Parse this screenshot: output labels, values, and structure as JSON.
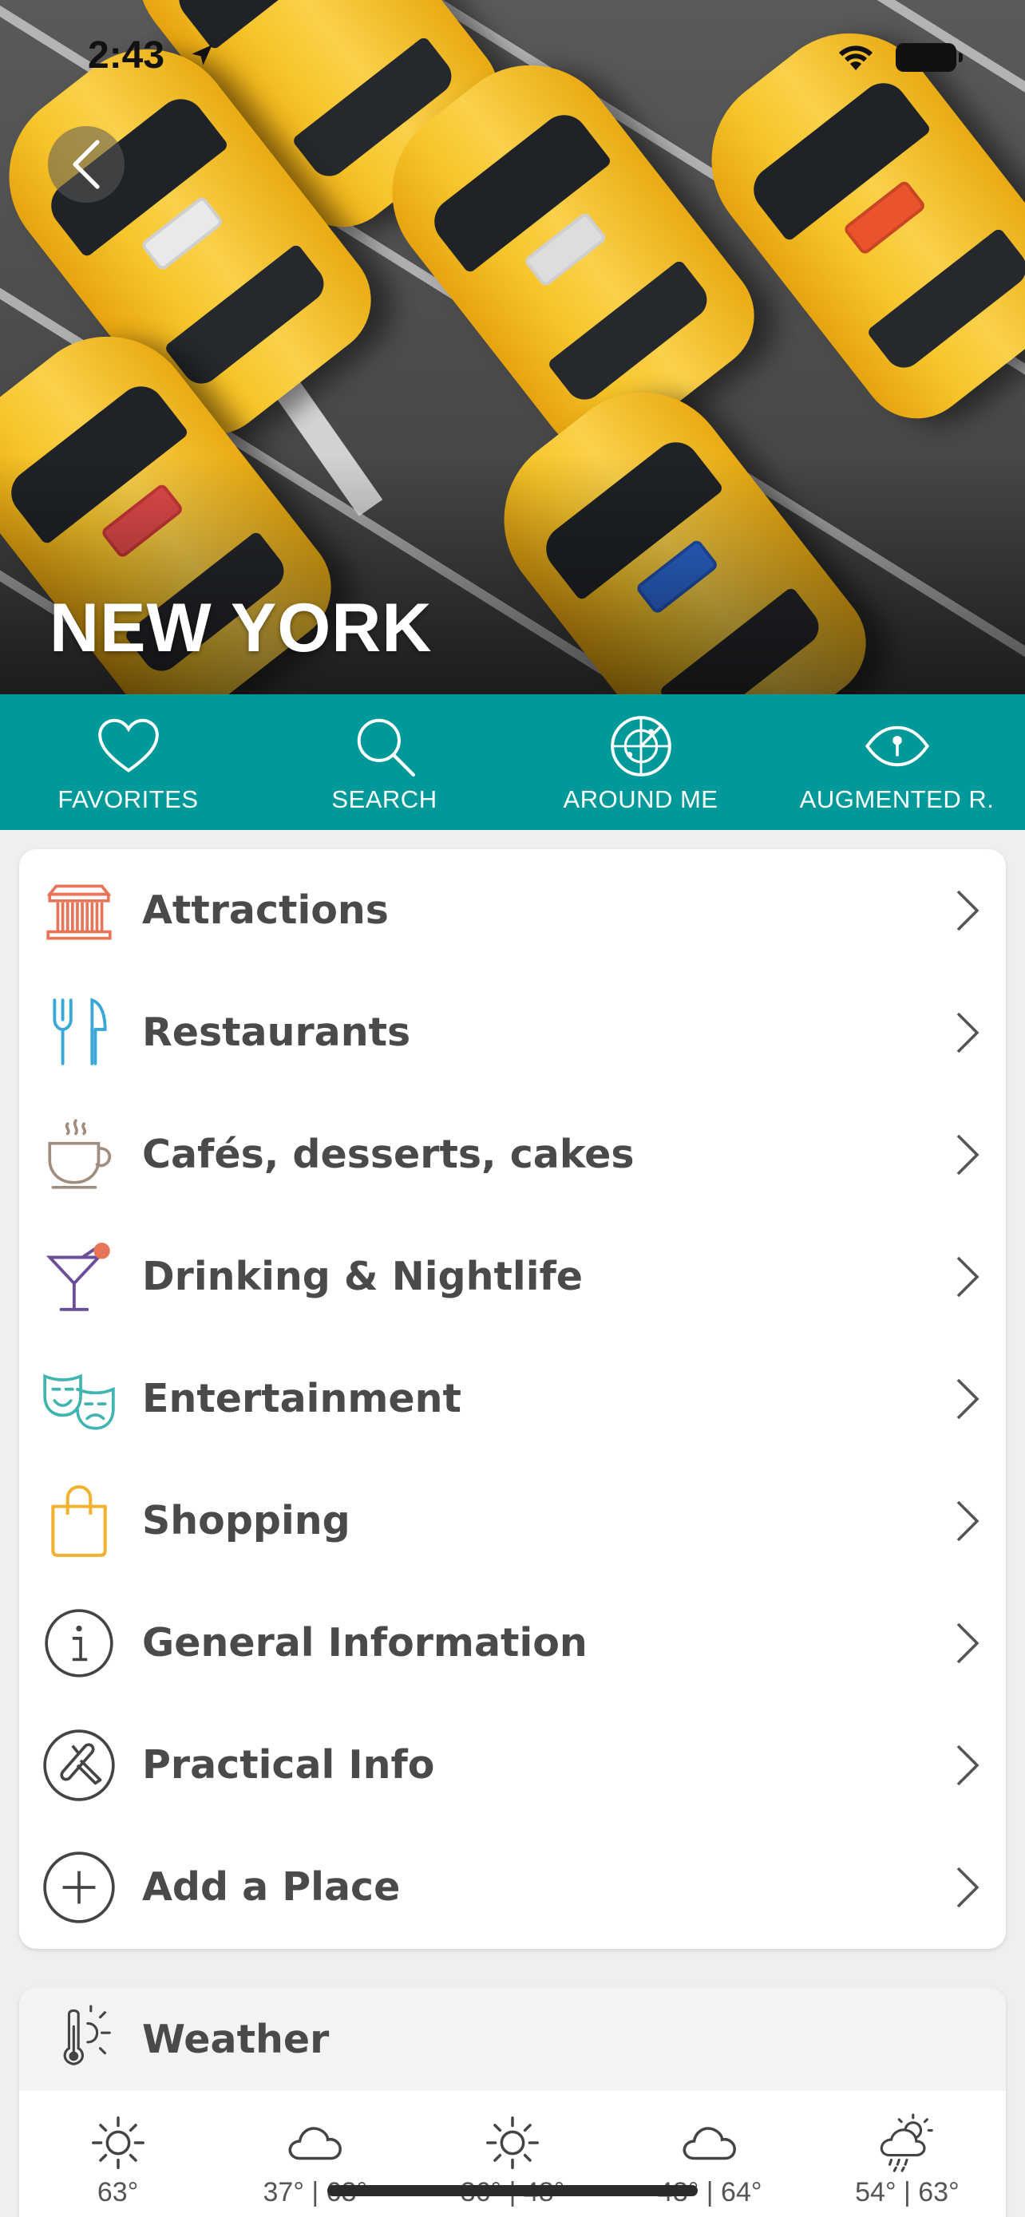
{
  "status_bar": {
    "time": "2:43"
  },
  "hero": {
    "city": "NEW YORK"
  },
  "tabs": [
    {
      "label": "FAVORITES",
      "icon": "heart-icon"
    },
    {
      "label": "SEARCH",
      "icon": "search-icon"
    },
    {
      "label": "AROUND ME",
      "icon": "radar-icon"
    },
    {
      "label": "AUGMENTED R.",
      "icon": "eye-icon"
    }
  ],
  "menu": [
    {
      "label": "Attractions",
      "icon": "landmark-icon",
      "color": "#e8745a"
    },
    {
      "label": "Restaurants",
      "icon": "fork-knife-icon",
      "color": "#3aa8d6"
    },
    {
      "label": "Cafés, desserts, cakes",
      "icon": "coffee-cup-icon",
      "color": "#a08d80"
    },
    {
      "label": "Drinking & Nightlife",
      "icon": "cocktail-icon",
      "color": "#6b4e9a"
    },
    {
      "label": "Entertainment",
      "icon": "theater-masks-icon",
      "color": "#3fb4b0"
    },
    {
      "label": "Shopping",
      "icon": "shopping-bag-icon",
      "color": "#f2b12f"
    },
    {
      "label": "General Information",
      "icon": "info-icon",
      "color": "#444444"
    },
    {
      "label": "Practical Info",
      "icon": "swiss-knife-icon",
      "color": "#444444"
    },
    {
      "label": "Add a Place",
      "icon": "plus-circle-icon",
      "color": "#444444"
    }
  ],
  "weather": {
    "title": "Weather",
    "days": [
      {
        "icon": "sun-icon",
        "temp": "63°"
      },
      {
        "icon": "cloud-icon",
        "temp": "37° | 63°"
      },
      {
        "icon": "sun-icon",
        "temp": "36° | 48°"
      },
      {
        "icon": "cloud-icon",
        "temp": "43° | 64°"
      },
      {
        "icon": "sun-rain-icon",
        "temp": "54° | 63°"
      }
    ]
  },
  "colors": {
    "accent": "#00999a",
    "text": "#4a4a4a"
  }
}
